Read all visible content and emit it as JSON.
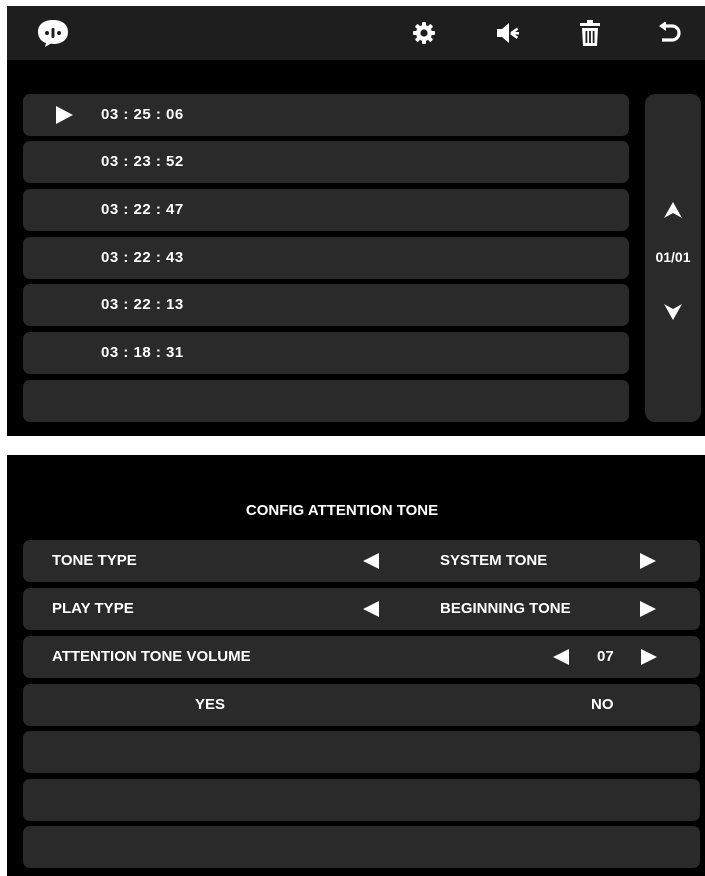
{
  "screen1": {
    "toolbar": {
      "icons": [
        "chat-bubble-icon",
        "gear-icon",
        "speaker-icon",
        "trash-icon",
        "back-arrow-icon"
      ]
    },
    "records": [
      {
        "time": "03 : 25 : 06",
        "playing": true
      },
      {
        "time": "03 : 23 : 52"
      },
      {
        "time": "03 : 22 : 47"
      },
      {
        "time": "03 : 22 : 43"
      },
      {
        "time": "03 : 22 : 13"
      },
      {
        "time": "03 : 18 : 31"
      },
      {
        "time": ""
      }
    ],
    "pager": {
      "page": "01/01"
    }
  },
  "screen2": {
    "title": "CONFIG ATTENTION TONE",
    "rows": [
      {
        "label": "TONE TYPE",
        "value": "SYSTEM TONE"
      },
      {
        "label": "PLAY TYPE",
        "value": "BEGINNING TONE"
      },
      {
        "label": "ATTENTION TONE VOLUME",
        "value": "07"
      }
    ],
    "yes_label": "YES",
    "no_label": "NO"
  },
  "colors": {
    "screen_bg": "#000000",
    "toolbar_bg": "#1e1e1e",
    "row_bg": "#2a2a2a",
    "text": "#ffffff"
  }
}
